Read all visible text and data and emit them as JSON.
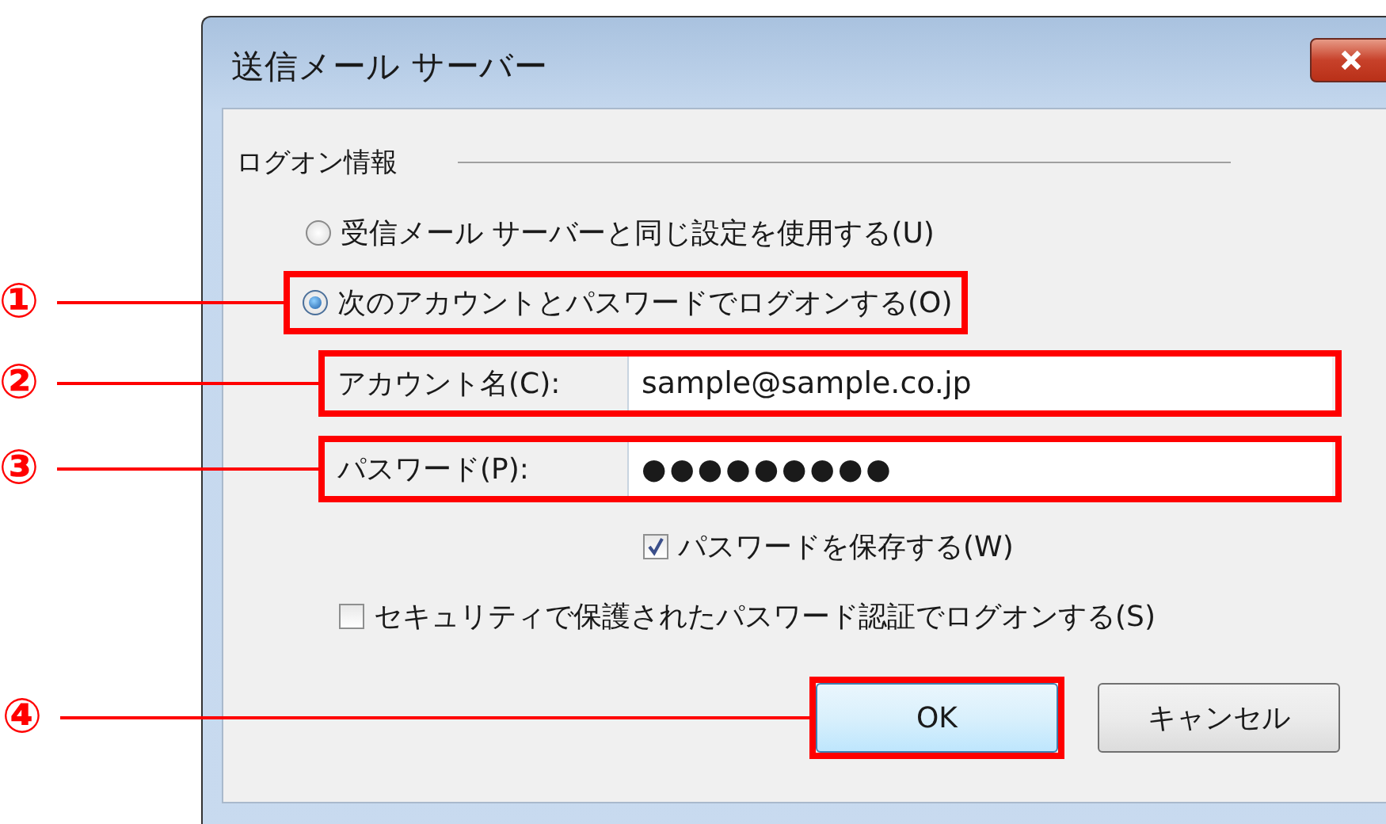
{
  "window": {
    "title": "送信メール サーバー"
  },
  "group": {
    "label": "ログオン情報"
  },
  "radios": [
    {
      "label": "受信メール サーバーと同じ設定を使用する(U)",
      "selected": false,
      "highlighted": false
    },
    {
      "label": "次のアカウントとパスワードでログオンする(O)",
      "selected": true,
      "highlighted": true,
      "callout": "①"
    }
  ],
  "fields": [
    {
      "label": "アカウント名(C):",
      "value": "sample@sample.co.jp",
      "kind": "text",
      "highlighted": true,
      "callout": "②"
    },
    {
      "label": "パスワード(P):",
      "value": "●●●●●●●●●",
      "kind": "password",
      "highlighted": true,
      "callout": "③"
    }
  ],
  "checkboxes": [
    {
      "label": "パスワードを保存する(W)",
      "checked": true
    },
    {
      "label": "セキュリティで保護されたパスワード認証でログオンする(S)",
      "checked": false
    }
  ],
  "buttons": [
    {
      "label": "OK",
      "default": true,
      "highlighted": true,
      "callout": "④"
    },
    {
      "label": "キャンセル",
      "default": false,
      "highlighted": false
    }
  ]
}
